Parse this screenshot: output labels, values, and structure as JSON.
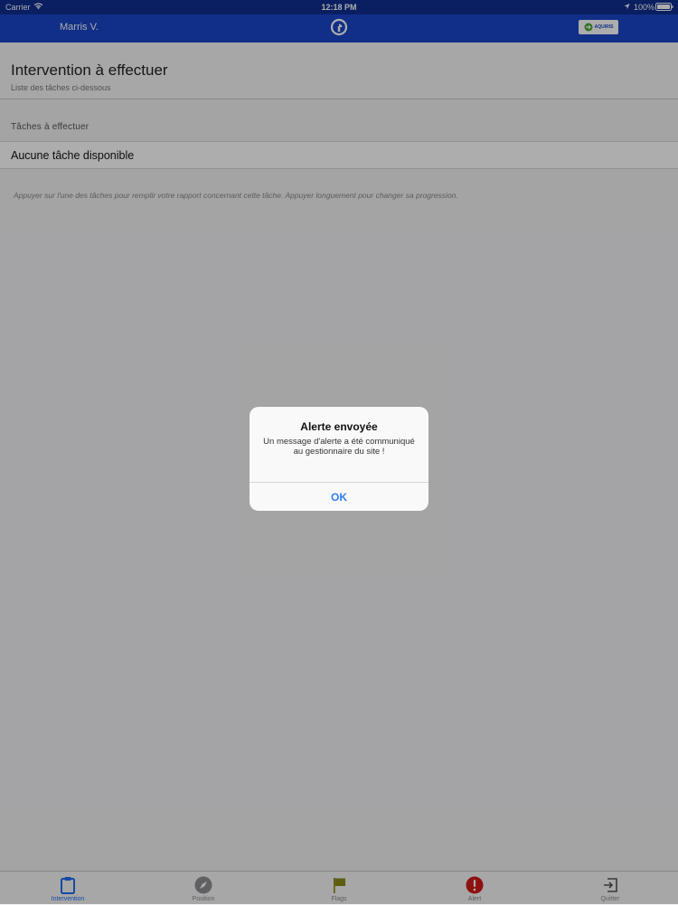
{
  "status_bar": {
    "carrier": "Carrier",
    "time": "12:18 PM",
    "battery": "100%"
  },
  "nav_bar": {
    "user_name": "Marris V.",
    "partner_logo_text": "AQUIRIS"
  },
  "content": {
    "title": "Intervention à effectuer",
    "subtitle": "Liste des tâches ci-dessous",
    "section_header": "Tâches à effectuer",
    "task_row_label": "Aucune tâche disponible",
    "hint": "Appuyer sur l'une des tâches pour remplir votre rapport concernant cette tâche. Appuyer longuement pour changer sa progression."
  },
  "tab_bar": {
    "tabs": [
      {
        "label": "Intervention",
        "icon": "clipboard-icon",
        "active": true
      },
      {
        "label": "Position",
        "icon": "compass-icon",
        "active": false
      },
      {
        "label": "Flags",
        "icon": "flag-icon",
        "active": false
      },
      {
        "label": "Alert",
        "icon": "alert-icon",
        "active": false
      },
      {
        "label": "Quitter",
        "icon": "exit-icon",
        "active": false
      }
    ]
  },
  "alert": {
    "title": "Alerte envoyée",
    "message": "Un message d'alerte a été communiqué au gestionnaire du site !",
    "ok_label": "OK"
  },
  "colors": {
    "status_bar": "#0e2f8f",
    "nav_bar": "#1a46c8",
    "accent": "#1e6ef0",
    "alert_red": "#d11a1a",
    "flag_olive": "#8a8a18"
  }
}
